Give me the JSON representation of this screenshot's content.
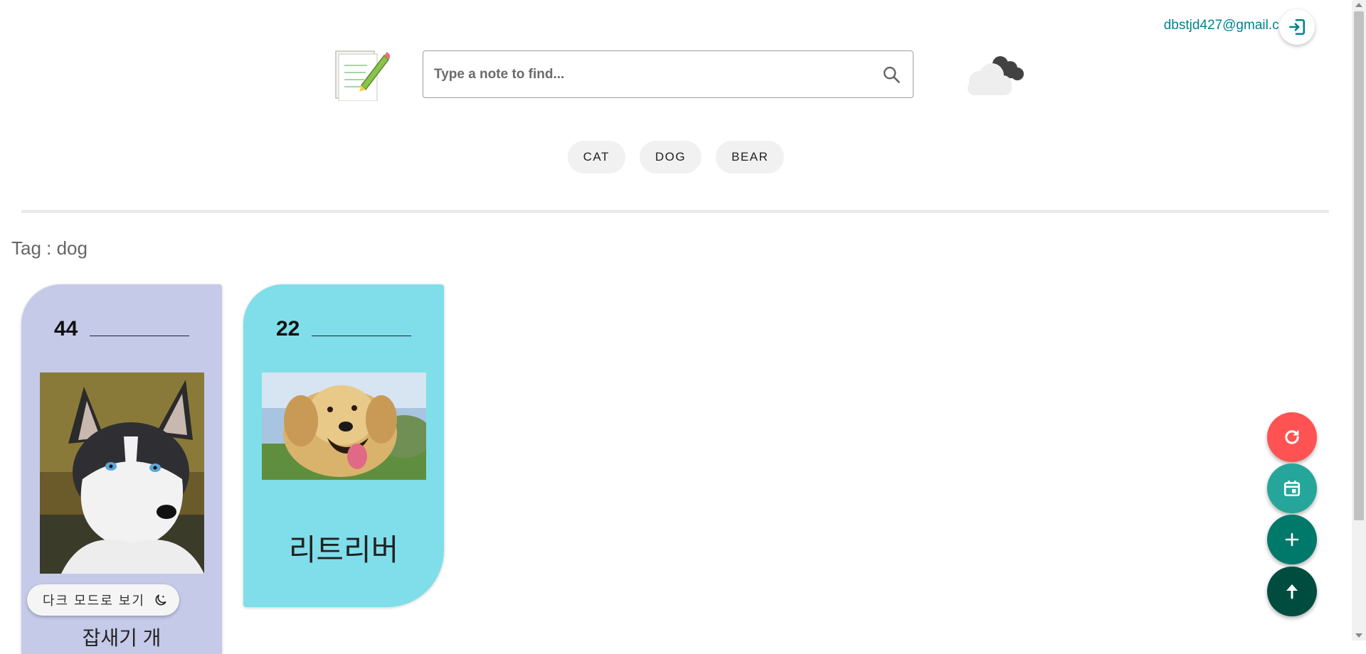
{
  "user": {
    "email": "dbstjd427@gmail.com",
    "logout_icon": "logout-icon"
  },
  "header": {
    "logo_icon": "notepad-pencil-icon",
    "search": {
      "placeholder": "Type a note to find...",
      "value": "",
      "icon": "search-icon"
    },
    "weather_icon": "cloudy-icon"
  },
  "tags": [
    "CAT",
    "DOG",
    "BEAR"
  ],
  "current_tag": {
    "text": "Tag : dog"
  },
  "cards": [
    {
      "number": "44",
      "title": "잡새기 개",
      "image": "husky-dog-photo",
      "color": "#c5cae9"
    },
    {
      "number": "22",
      "title": "리트리버",
      "image": "golden-retriever-photo",
      "color": "#80deea"
    }
  ],
  "dark_mode_toggle": {
    "label": "다크 모드로 보기",
    "icon": "moon-icon"
  },
  "fabs": [
    {
      "name": "refresh",
      "icon": "refresh-icon",
      "color": "#ff5252"
    },
    {
      "name": "calendar",
      "icon": "calendar-icon",
      "color": "#26a69a"
    },
    {
      "name": "add",
      "icon": "plus-icon",
      "color": "#00796b"
    },
    {
      "name": "scroll-top",
      "icon": "arrow-up-icon",
      "color": "#004d40"
    }
  ]
}
